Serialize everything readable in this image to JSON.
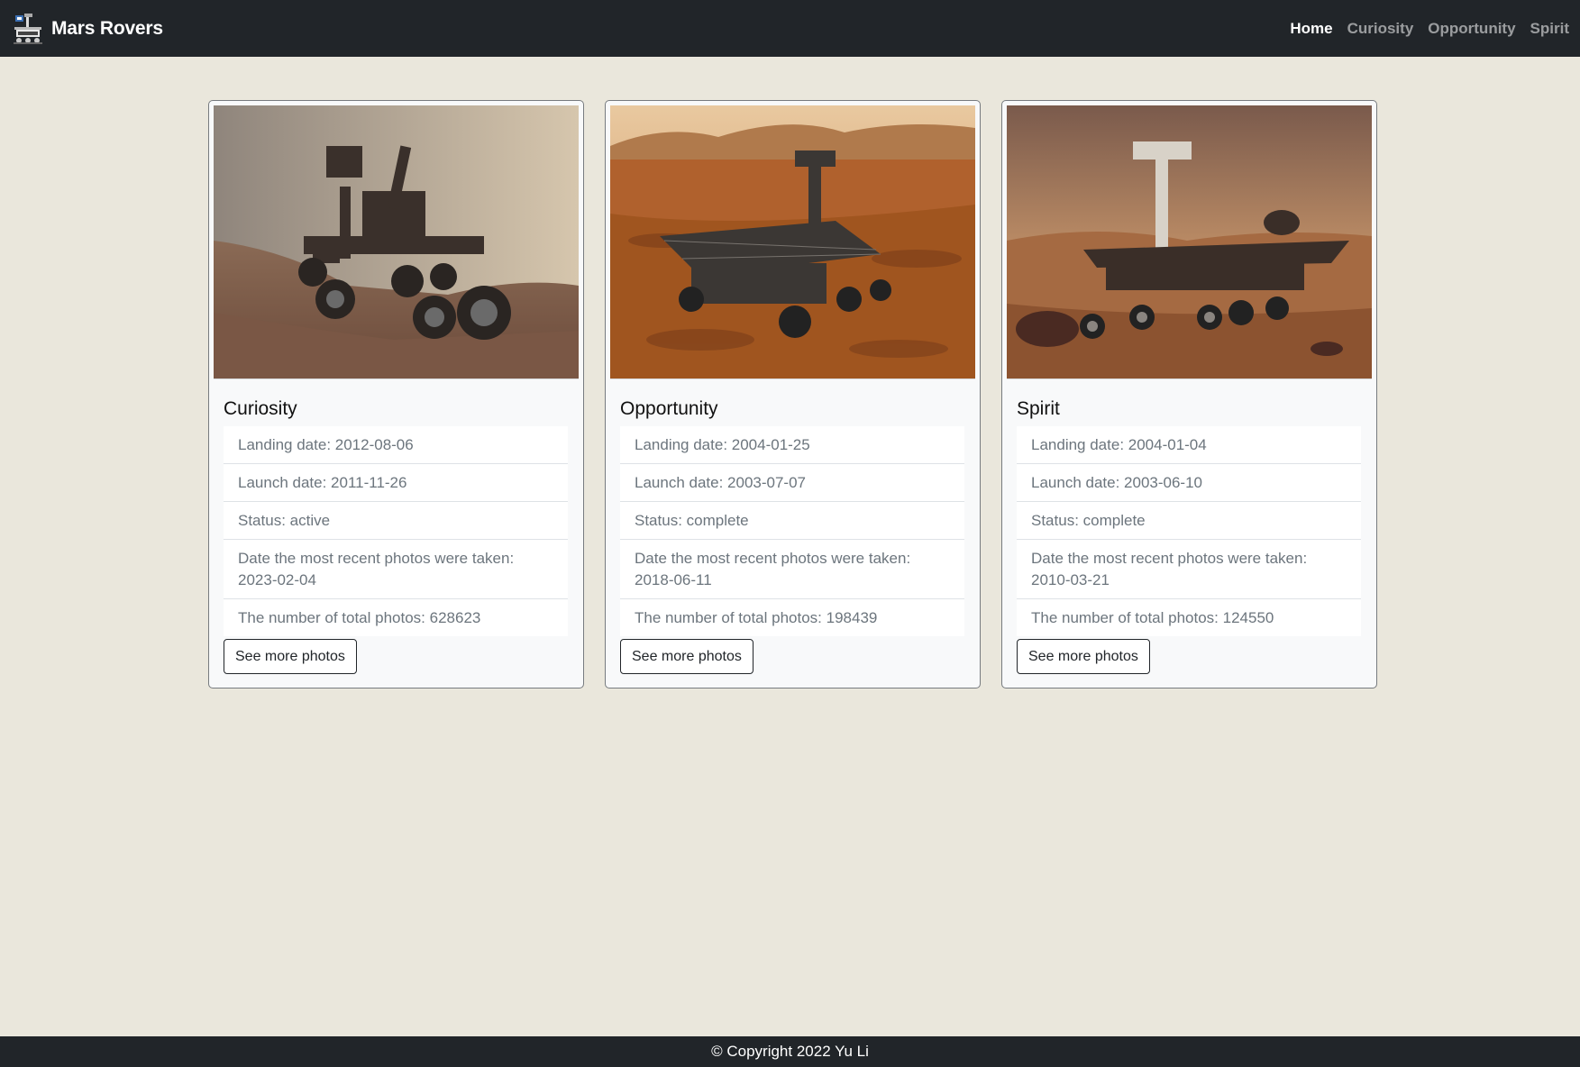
{
  "navbar": {
    "brand": "Mars Rovers",
    "logo_icon": "rover-logo-icon",
    "links": [
      {
        "label": "Home",
        "active": true
      },
      {
        "label": "Curiosity",
        "active": false
      },
      {
        "label": "Opportunity",
        "active": false
      },
      {
        "label": "Spirit",
        "active": false
      }
    ]
  },
  "rovers": [
    {
      "name": "Curiosity",
      "image": "curiosity-rover-photo",
      "info": [
        "Landing date: 2012-08-06",
        "Launch date: 2011-11-26",
        "Status: active",
        "Date the most recent photos were taken: 2023-02-04",
        "The number of total photos: 628623"
      ],
      "button": "See more photos"
    },
    {
      "name": "Opportunity",
      "image": "opportunity-rover-photo",
      "info": [
        "Landing date: 2004-01-25",
        "Launch date: 2003-07-07",
        "Status: complete",
        "Date the most recent photos were taken: 2018-06-11",
        "The number of total photos: 198439"
      ],
      "button": "See more photos"
    },
    {
      "name": "Spirit",
      "image": "spirit-rover-photo",
      "info": [
        "Landing date: 2004-01-04",
        "Launch date: 2003-06-10",
        "Status: complete",
        "Date the most recent photos were taken: 2010-03-21",
        "The number of total photos: 124550"
      ],
      "button": "See more photos"
    }
  ],
  "footer": {
    "text": "© Copyright 2022 Yu Li"
  },
  "colors": {
    "navbar_bg": "#212529",
    "page_bg": "#eae7dc",
    "card_bg": "#f8f9fa",
    "muted_text": "#6c757d"
  }
}
